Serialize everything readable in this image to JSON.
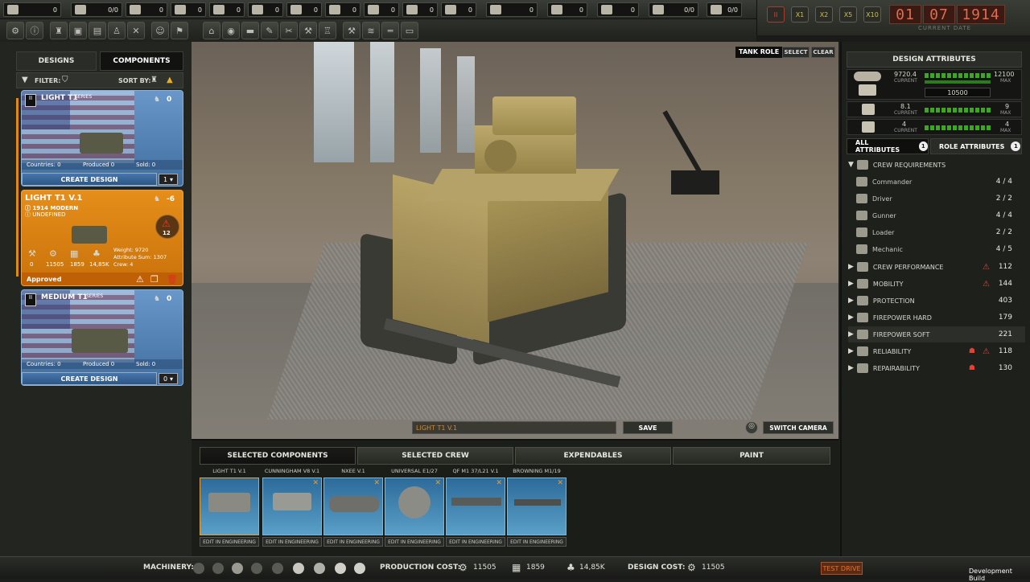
{
  "topbar": {
    "resources": [
      "0",
      "0/0",
      "0",
      "0",
      "0",
      "0",
      "0",
      "0",
      "0",
      "0",
      "0",
      "0",
      "0",
      "0",
      "0/0"
    ]
  },
  "time": {
    "speeds": [
      "II",
      "X1",
      "X2",
      "X5",
      "X10"
    ],
    "day": "01",
    "month": "07",
    "year": "1914",
    "date_label": "CURRENT DATE"
  },
  "left": {
    "tab_designs": "DESIGNS",
    "tab_components": "COMPONENTS",
    "filter_label": "FILTER:",
    "sortby_label": "SORT BY:",
    "cards": [
      {
        "title": "LIGHT T1",
        "series": "SERIES",
        "count": "0",
        "countries": "Countries: 0",
        "produced": "Produced 0",
        "sold": "Sold: 0",
        "button": "CREATE DESIGN",
        "dropdown": "1"
      },
      {
        "title": "LIGHT T1 V.1",
        "count": "-6",
        "era": "1914 MODERN",
        "role": "UNDEFINED",
        "level": "12",
        "weight": "Weight: 9720",
        "attr_sum": "Attribute Sum: 1307",
        "crew": "Crew: 4",
        "stat_a": "0",
        "stat_b": "11505",
        "stat_c": "1859",
        "stat_d": "14,85K",
        "status": "Approved"
      },
      {
        "title": "MEDIUM T1",
        "series": "SERIES",
        "count": "0",
        "countries": "Countries: 0",
        "produced": "Produced 0",
        "sold": "Sold: 0",
        "button": "CREATE DESIGN",
        "dropdown": "0"
      }
    ]
  },
  "viewport": {
    "tank_role_label": "TANK ROLE",
    "select_label": "SELECT",
    "clear_label": "CLEAR",
    "name_value": "LIGHT T1 V.1",
    "save_label": "SAVE",
    "switch_camera_label": "SWITCH CAMERA"
  },
  "right": {
    "title": "DESIGN ATTRIBUTES",
    "attr1": {
      "current": "9720.4",
      "current_label": "CURRENT",
      "max": "12100",
      "max_label": "MAX",
      "sub": "10500"
    },
    "attr2": {
      "current": "8.1",
      "current_label": "CURRENT",
      "max": "9",
      "max_label": "MAX"
    },
    "attr3": {
      "current": "4",
      "current_label": "CURRENT",
      "max": "4",
      "max_label": "MAX"
    },
    "tab_all": "ALL ATTRIBUTES",
    "tab_all_badge": "1",
    "tab_role": "ROLE ATTRIBUTES",
    "tab_role_badge": "1",
    "crew_req": "CREW REQUIREMENTS",
    "crew": [
      {
        "name": "Commander",
        "value": "4 / 4"
      },
      {
        "name": "Driver",
        "value": "2 / 2"
      },
      {
        "name": "Gunner",
        "value": "4 / 4"
      },
      {
        "name": "Loader",
        "value": "2 / 2"
      },
      {
        "name": "Mechanic",
        "value": "4 / 5"
      }
    ],
    "attributes": [
      {
        "name": "CREW PERFORMANCE",
        "value": "112"
      },
      {
        "name": "MOBILITY",
        "value": "144"
      },
      {
        "name": "PROTECTION",
        "value": "403"
      },
      {
        "name": "FIREPOWER HARD",
        "value": "179"
      },
      {
        "name": "FIREPOWER SOFT",
        "value": "221"
      },
      {
        "name": "RELIABILITY",
        "value": "118"
      },
      {
        "name": "REPAIRABILITY",
        "value": "130"
      }
    ]
  },
  "bottom": {
    "tabs": [
      "SELECTED COMPONENTS",
      "SELECTED CREW",
      "EXPENDABLES",
      "PAINT"
    ],
    "components": [
      {
        "label": "LIGHT T1 V.1",
        "edit": "EDIT IN ENGINEERING"
      },
      {
        "label": "CUNNINGHAM V8 V.1",
        "edit": "EDIT IN ENGINEERING"
      },
      {
        "label": "NXEE V.1",
        "edit": "EDIT IN ENGINEERING"
      },
      {
        "label": "UNIVERSAL E1/27",
        "edit": "EDIT IN ENGINEERING"
      },
      {
        "label": "QF M1 37/L21 V.1",
        "edit": "EDIT IN ENGINEERING"
      },
      {
        "label": "BROWNING M1/19",
        "edit": "EDIT IN ENGINEERING"
      }
    ]
  },
  "footer": {
    "machinery_label": "MACHINERY:",
    "production_label": "PRODUCTION COST:",
    "prod_a": "11505",
    "prod_b": "1859",
    "prod_c": "14,85K",
    "design_label": "DESIGN COST:",
    "design_a": "11505",
    "test_drive": "TEST DRIVE",
    "dev_build": "Development Build"
  }
}
